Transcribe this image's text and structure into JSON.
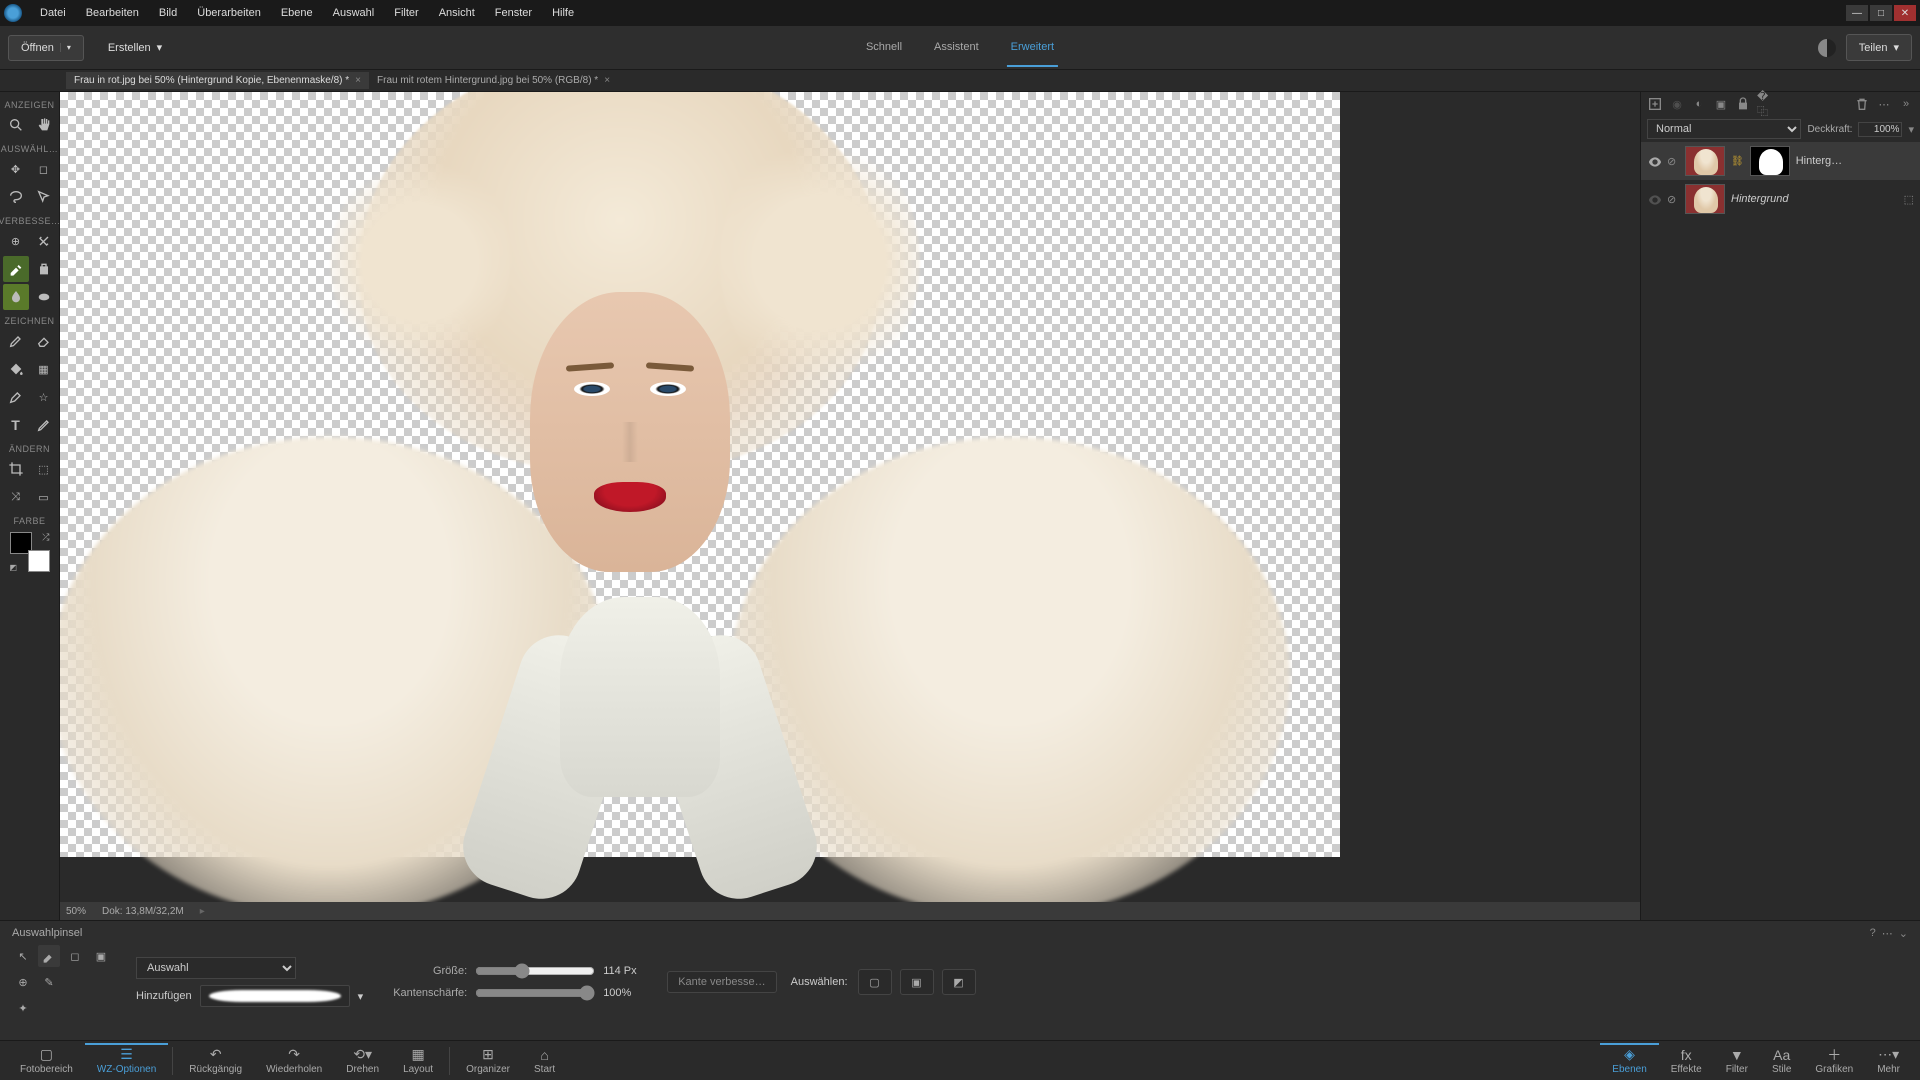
{
  "menu": [
    "Datei",
    "Bearbeiten",
    "Bild",
    "Überarbeiten",
    "Ebene",
    "Auswahl",
    "Filter",
    "Ansicht",
    "Fenster",
    "Hilfe"
  ],
  "toolbar": {
    "open": "Öffnen",
    "create": "Erstellen",
    "share": "Teilen"
  },
  "modes": {
    "quick": "Schnell",
    "assistant": "Assistent",
    "expert": "Erweitert"
  },
  "doc_tabs": [
    {
      "title": "Frau in rot.jpg bei 50% (Hintergrund Kopie, Ebenenmaske/8) *",
      "active": true
    },
    {
      "title": "Frau mit rotem Hintergrund.jpg bei 50% (RGB/8) *",
      "active": false
    }
  ],
  "tool_sections": {
    "view": "ANZEIGEN",
    "select": "AUSWÄHL…",
    "enhance": "VERBESSE…",
    "draw": "ZEICHNEN",
    "modify": "ÄNDERN",
    "color": "FARBE"
  },
  "status": {
    "zoom": "50%",
    "doc_size": "Dok: 13,8M/32,2M"
  },
  "layers": {
    "blend_mode": "Normal",
    "opacity_label": "Deckkraft:",
    "opacity_value": "100%",
    "rows": [
      {
        "name": "Hinterg…",
        "visible": true,
        "italic": false
      },
      {
        "name": "Hintergrund",
        "visible": false,
        "italic": true
      }
    ]
  },
  "tool_options": {
    "tool_name": "Auswahlpinsel",
    "mode_select": "Auswahl",
    "add_label": "Hinzufügen",
    "size_label": "Größe:",
    "size_value": "114 Px",
    "hardness_label": "Kantenschärfe:",
    "hardness_value": "100%",
    "refine_edge": "Kante verbesse…",
    "select_label": "Auswählen:"
  },
  "bottom_bar": {
    "left": [
      {
        "key": "photo_bin",
        "label": "Fotobereich"
      },
      {
        "key": "tool_opts",
        "label": "WZ-Optionen",
        "active": true
      },
      {
        "key": "undo",
        "label": "Rückgängig"
      },
      {
        "key": "redo",
        "label": "Wiederholen"
      },
      {
        "key": "rotate",
        "label": "Drehen"
      },
      {
        "key": "layout",
        "label": "Layout"
      },
      {
        "key": "organizer",
        "label": "Organizer"
      },
      {
        "key": "start",
        "label": "Start"
      }
    ],
    "right": [
      {
        "key": "layers",
        "label": "Ebenen",
        "active": true
      },
      {
        "key": "effects",
        "label": "Effekte"
      },
      {
        "key": "filter",
        "label": "Filter"
      },
      {
        "key": "styles",
        "label": "Stile"
      },
      {
        "key": "graphics",
        "label": "Grafiken"
      },
      {
        "key": "more",
        "label": "Mehr"
      }
    ]
  }
}
